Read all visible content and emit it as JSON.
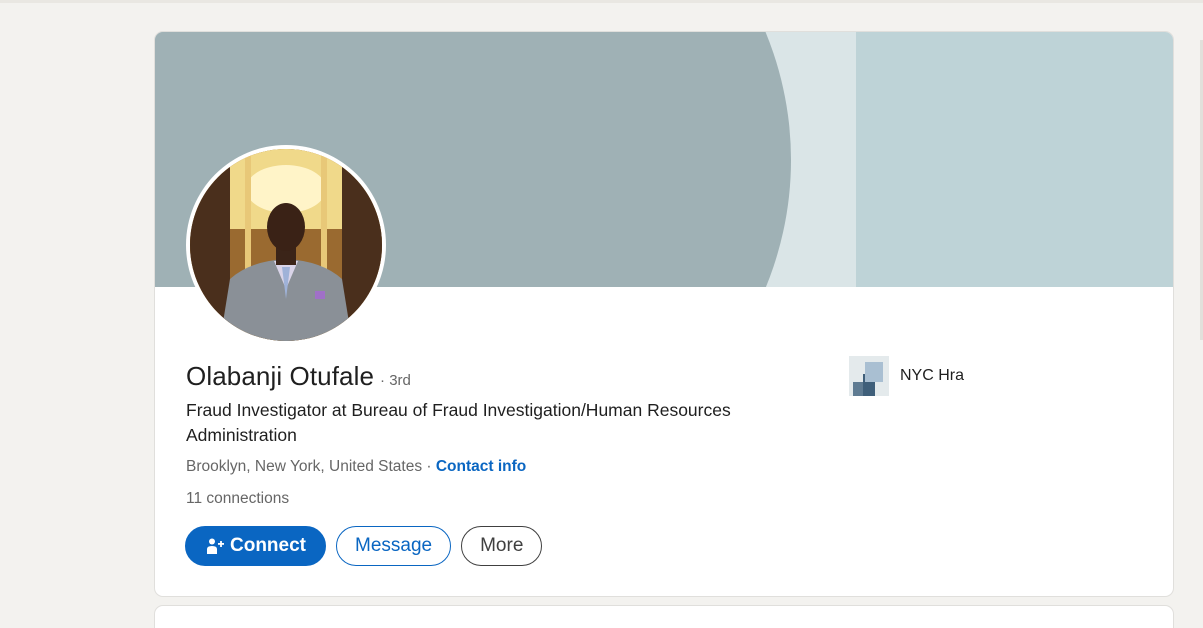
{
  "profile": {
    "name": "Olabanji Otufale",
    "degree": "· 3rd",
    "headline": "Fraud Investigator at Bureau of Fraud Investigation/Human Resources Administration",
    "location": "Brooklyn, New York, United States",
    "separator": " · ",
    "contact_info_label": "Contact info",
    "connections": "11 connections"
  },
  "actions": {
    "connect_label": "Connect",
    "message_label": "Message",
    "more_label": "More"
  },
  "company": {
    "name": "NYC Hra",
    "logo_icon": "company-logo-icon"
  },
  "colors": {
    "accent": "#0a66c2",
    "banner": "#9fb1b5",
    "background": "#f3f2ef"
  },
  "icons": {
    "connect": "add-person-icon"
  }
}
